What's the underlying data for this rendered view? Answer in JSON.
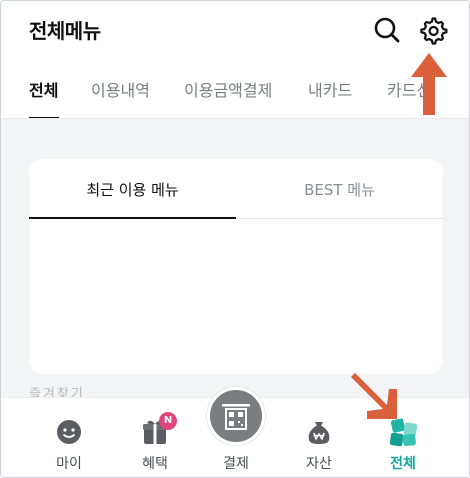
{
  "header": {
    "title": "전체메뉴"
  },
  "tabs": [
    {
      "label": "전체",
      "active": true
    },
    {
      "label": "이용내역",
      "active": false
    },
    {
      "label": "이용금액결제",
      "active": false
    },
    {
      "label": "내카드",
      "active": false
    },
    {
      "label": "카드신",
      "active": false
    }
  ],
  "card": {
    "tabs": [
      {
        "label": "최근 이용 메뉴",
        "active": true
      },
      {
        "label": "BEST 메뉴",
        "active": false
      }
    ]
  },
  "faded_text": "즐겨찾기",
  "bottom_nav": {
    "items": [
      {
        "label": "마이",
        "icon": "face-icon",
        "active": false
      },
      {
        "label": "혜택",
        "icon": "gift-icon",
        "active": false,
        "badge": "N"
      },
      {
        "label": "결제",
        "icon": "qr-pay-icon",
        "active": false
      },
      {
        "label": "자산",
        "icon": "money-bag-icon",
        "active": false
      },
      {
        "label": "전체",
        "icon": "all-menu-icon",
        "active": true
      }
    ]
  },
  "colors": {
    "accent": "#12a89a",
    "annotation_arrow": "#d9603b",
    "badge": "#e0457b",
    "background": "#f3f4f6"
  }
}
